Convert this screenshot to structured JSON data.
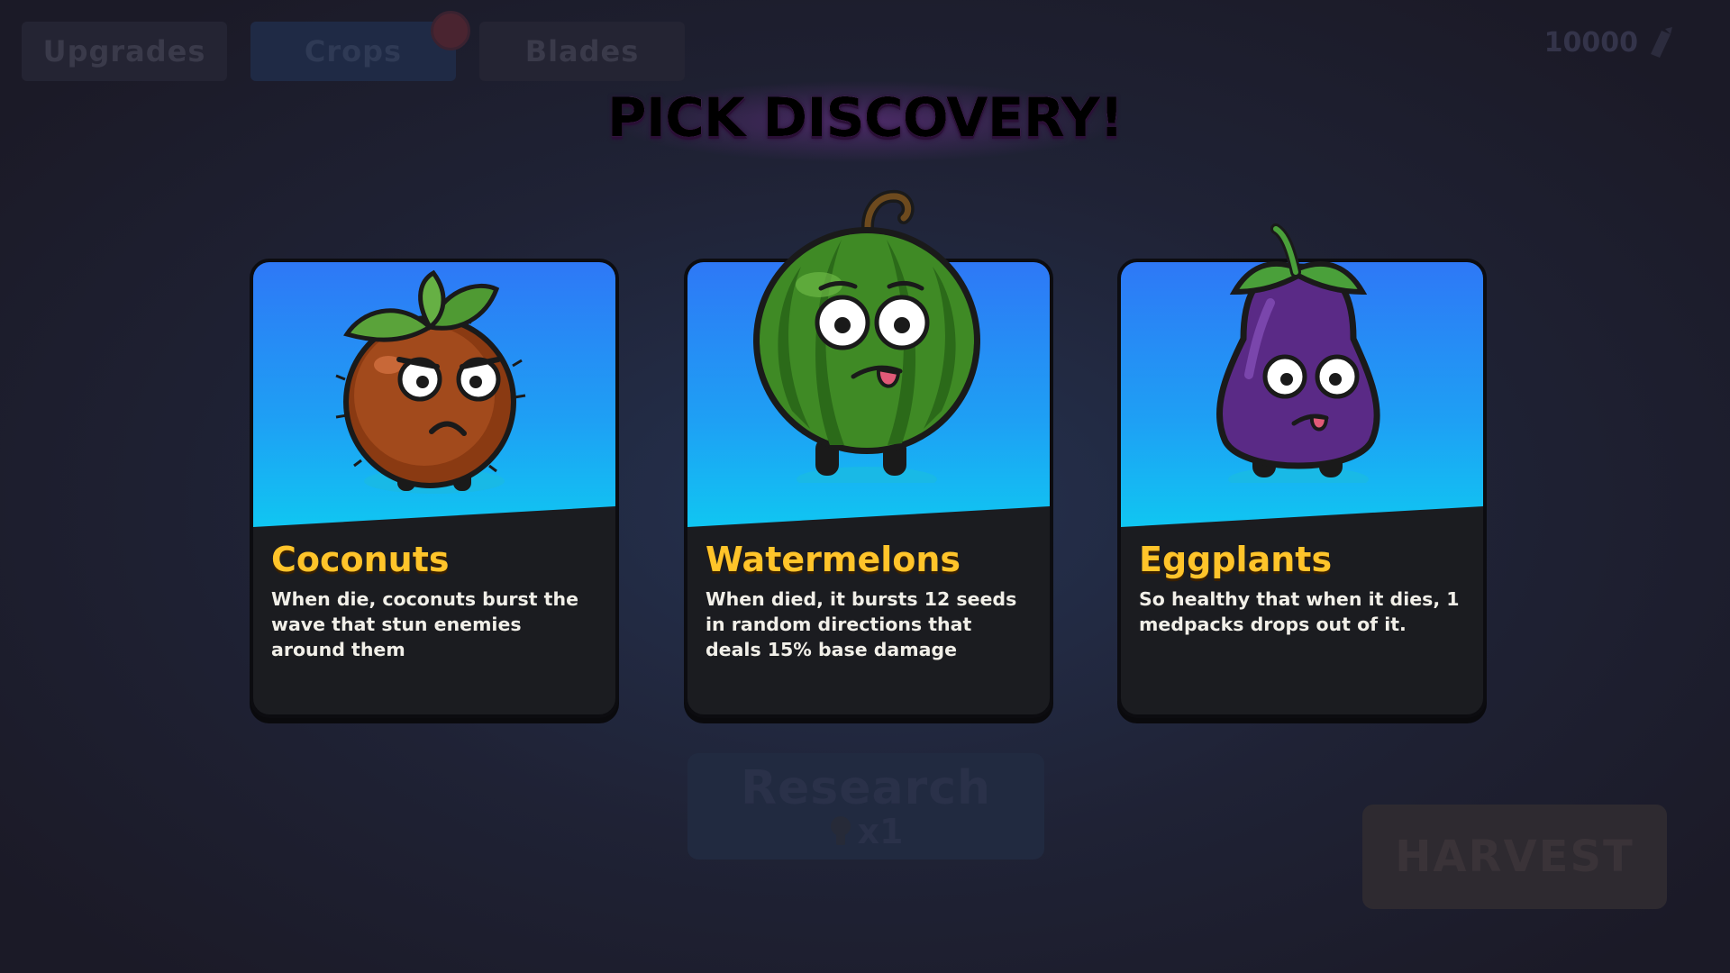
{
  "tabs": [
    {
      "label": "Upgrades",
      "active": false
    },
    {
      "label": "Crops",
      "active": true
    },
    {
      "label": "Blades",
      "active": false
    }
  ],
  "currency": {
    "amount": "10000",
    "icon": "seed-token-icon"
  },
  "title": "PICK DISCOVERY!",
  "cards": [
    {
      "name": "Coconuts",
      "description": "When die, coconuts burst the wave that stun enemies around them",
      "icon": "coconut-character-icon"
    },
    {
      "name": "Watermelons",
      "description": "When died, it bursts 12 seeds in random directions that deals 15% base damage",
      "icon": "watermelon-character-icon"
    },
    {
      "name": "Eggplants",
      "description": "So healthy that when it dies, 1 medpacks drops out of it.",
      "icon": "eggplant-character-icon"
    }
  ],
  "research": {
    "label": "Research",
    "count": "x1",
    "icon": "lightbulb-icon"
  },
  "harvest": {
    "label": "HARVEST"
  },
  "colors": {
    "title": "#d868f0",
    "card_name": "#ffc42a",
    "card_top": "#2e78f6",
    "card_bottom": "#10c6f2",
    "card_body": "#1b1c20"
  }
}
